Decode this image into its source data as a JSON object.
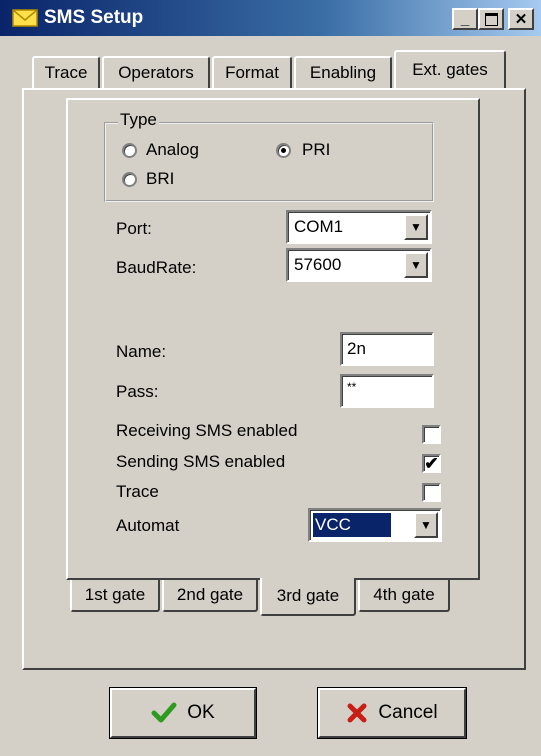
{
  "window": {
    "title": "SMS Setup",
    "icon": "envelope-icon",
    "controls": {
      "minimize": "minimize-icon",
      "maximize": "maximize-icon",
      "close": "close-icon"
    }
  },
  "tabs": [
    {
      "label": "Trace",
      "active": false
    },
    {
      "label": "Operators",
      "active": false
    },
    {
      "label": "Format",
      "active": false
    },
    {
      "label": "Enabling",
      "active": false
    },
    {
      "label": "Ext. gates",
      "active": true
    }
  ],
  "type_group": {
    "title": "Type",
    "options": [
      {
        "label": "Analog",
        "selected": false
      },
      {
        "label": "PRI",
        "selected": true
      },
      {
        "label": "BRI",
        "selected": false
      }
    ]
  },
  "port": {
    "label": "Port:",
    "value": "COM1"
  },
  "baudrate": {
    "label": "BaudRate:",
    "value": "57600"
  },
  "name": {
    "label": "Name:",
    "value": "2n"
  },
  "pass": {
    "label": "Pass:",
    "value": "**"
  },
  "receiving": {
    "label": "Receiving SMS enabled",
    "checked": false
  },
  "sending": {
    "label": "Sending SMS enabled",
    "checked": true
  },
  "trace": {
    "label": "Trace",
    "checked": false
  },
  "automat": {
    "label": "Automat",
    "value": "VCC"
  },
  "gate_tabs": [
    {
      "label": "1st gate",
      "active": false
    },
    {
      "label": "2nd gate",
      "active": false
    },
    {
      "label": "3rd gate",
      "active": true
    },
    {
      "label": "4th gate",
      "active": false
    }
  ],
  "buttons": {
    "ok": {
      "label": "OK",
      "icon": "checkmark-icon"
    },
    "cancel": {
      "label": "Cancel",
      "icon": "x-icon"
    }
  },
  "colors": {
    "title_start": "#0a246a",
    "title_end": "#a6caf0",
    "ok_icon": "#2e9a1e",
    "cancel_icon": "#c81e14",
    "selection": "#0a246a"
  }
}
